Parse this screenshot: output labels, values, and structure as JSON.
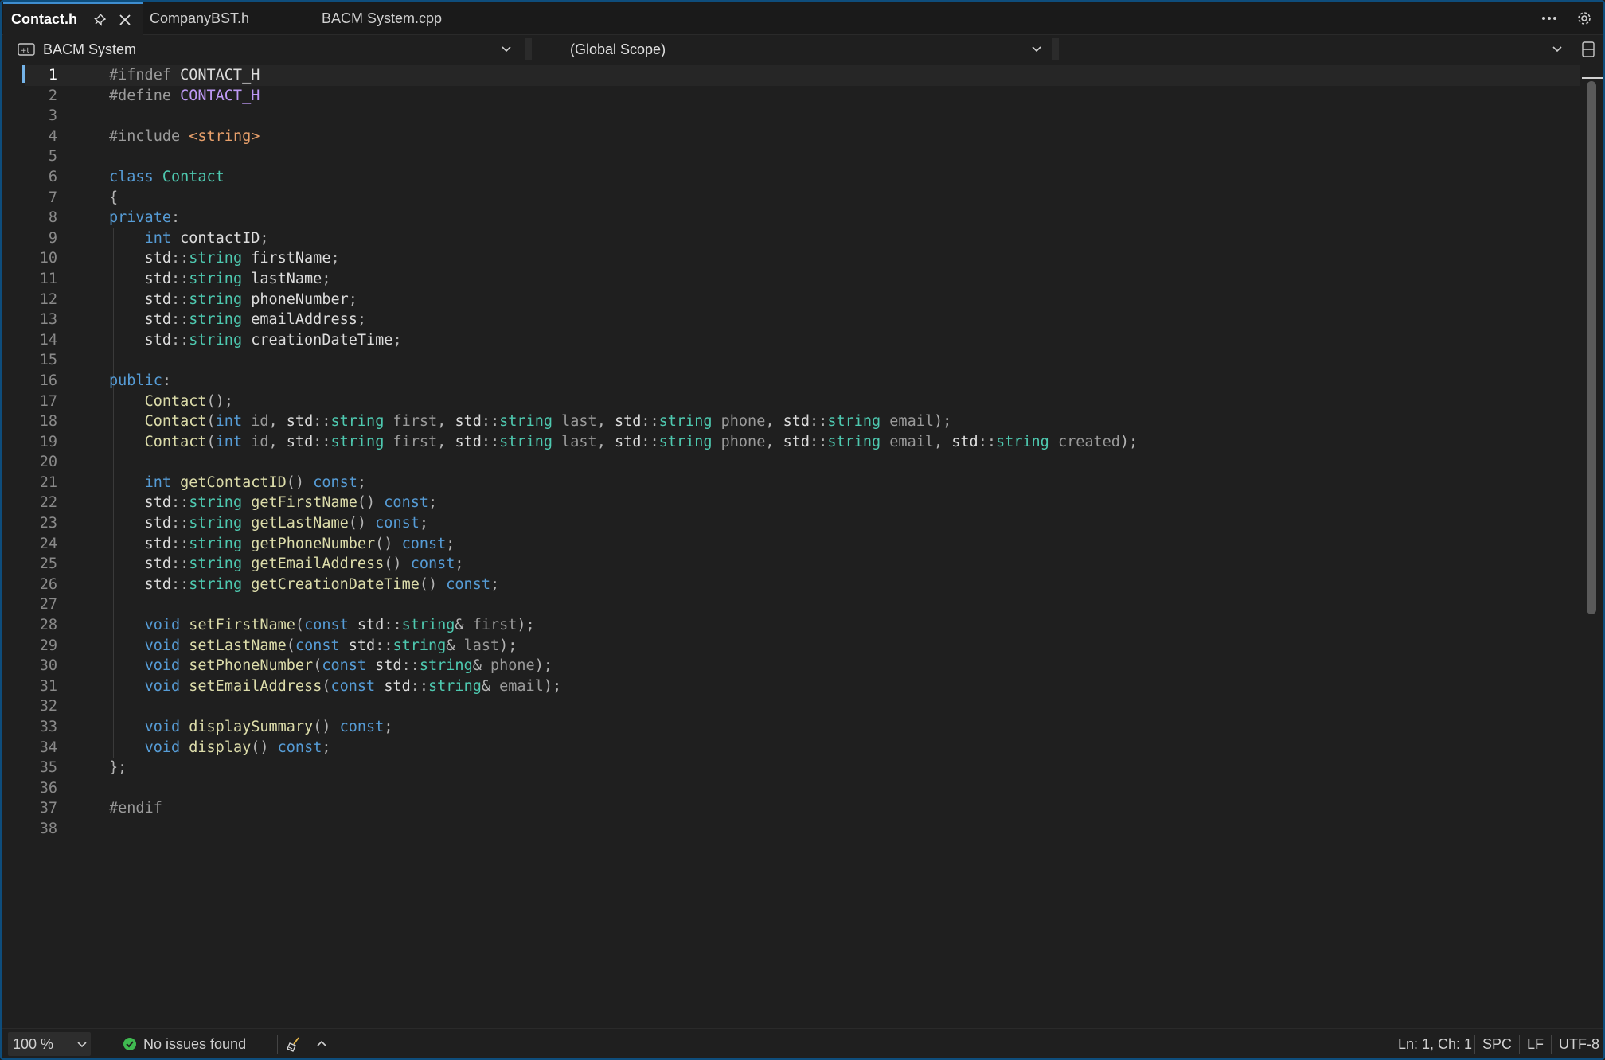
{
  "tabs": [
    {
      "label": "Contact.h",
      "active": true,
      "pinned": true
    },
    {
      "label": "CompanyBST.h",
      "active": false
    },
    {
      "label": "BACM System.cpp",
      "active": false
    }
  ],
  "navbar": {
    "project": "BACM System",
    "scope": "(Global Scope)",
    "member": ""
  },
  "editor": {
    "current_line": 1,
    "lines": [
      {
        "n": "1",
        "t": [
          [
            "pp",
            "#ifndef "
          ],
          [
            "pl",
            "CONTACT_H"
          ]
        ]
      },
      {
        "n": "2",
        "t": [
          [
            "pp",
            "#define "
          ],
          [
            "mc",
            "CONTACT_H"
          ]
        ]
      },
      {
        "n": "3",
        "t": []
      },
      {
        "n": "4",
        "t": [
          [
            "pp",
            "#include "
          ],
          [
            "st",
            "<string>"
          ]
        ]
      },
      {
        "n": "5",
        "t": []
      },
      {
        "n": "6",
        "t": [
          [
            "kw",
            "class "
          ],
          [
            "ty",
            "Contact"
          ]
        ]
      },
      {
        "n": "7",
        "t": [
          [
            "op",
            "{"
          ]
        ]
      },
      {
        "n": "8",
        "t": [
          [
            "kw",
            "private"
          ],
          [
            "op",
            ":"
          ]
        ]
      },
      {
        "n": "9",
        "t": [
          [
            "pl",
            "    "
          ],
          [
            "kw",
            "int "
          ],
          [
            "pl",
            "contactID"
          ],
          [
            "op",
            ";"
          ]
        ]
      },
      {
        "n": "10",
        "t": [
          [
            "pl",
            "    std"
          ],
          [
            "op",
            "::"
          ],
          [
            "ty",
            "string "
          ],
          [
            "pl",
            "firstName"
          ],
          [
            "op",
            ";"
          ]
        ]
      },
      {
        "n": "11",
        "t": [
          [
            "pl",
            "    std"
          ],
          [
            "op",
            "::"
          ],
          [
            "ty",
            "string "
          ],
          [
            "pl",
            "lastName"
          ],
          [
            "op",
            ";"
          ]
        ]
      },
      {
        "n": "12",
        "t": [
          [
            "pl",
            "    std"
          ],
          [
            "op",
            "::"
          ],
          [
            "ty",
            "string "
          ],
          [
            "pl",
            "phoneNumber"
          ],
          [
            "op",
            ";"
          ]
        ]
      },
      {
        "n": "13",
        "t": [
          [
            "pl",
            "    std"
          ],
          [
            "op",
            "::"
          ],
          [
            "ty",
            "string "
          ],
          [
            "pl",
            "emailAddress"
          ],
          [
            "op",
            ";"
          ]
        ]
      },
      {
        "n": "14",
        "t": [
          [
            "pl",
            "    std"
          ],
          [
            "op",
            "::"
          ],
          [
            "ty",
            "string "
          ],
          [
            "pl",
            "creationDateTime"
          ],
          [
            "op",
            ";"
          ]
        ]
      },
      {
        "n": "15",
        "t": []
      },
      {
        "n": "16",
        "t": [
          [
            "kw",
            "public"
          ],
          [
            "op",
            ":"
          ]
        ]
      },
      {
        "n": "17",
        "t": [
          [
            "pl",
            "    "
          ],
          [
            "fn",
            "Contact"
          ],
          [
            "op",
            "();"
          ]
        ]
      },
      {
        "n": "18",
        "t": [
          [
            "pl",
            "    "
          ],
          [
            "fn",
            "Contact"
          ],
          [
            "op",
            "("
          ],
          [
            "kw",
            "int "
          ],
          [
            "pm",
            "id"
          ],
          [
            "op",
            ", "
          ],
          [
            "pl",
            "std"
          ],
          [
            "op",
            "::"
          ],
          [
            "ty",
            "string "
          ],
          [
            "pm",
            "first"
          ],
          [
            "op",
            ", "
          ],
          [
            "pl",
            "std"
          ],
          [
            "op",
            "::"
          ],
          [
            "ty",
            "string "
          ],
          [
            "pm",
            "last"
          ],
          [
            "op",
            ", "
          ],
          [
            "pl",
            "std"
          ],
          [
            "op",
            "::"
          ],
          [
            "ty",
            "string "
          ],
          [
            "pm",
            "phone"
          ],
          [
            "op",
            ", "
          ],
          [
            "pl",
            "std"
          ],
          [
            "op",
            "::"
          ],
          [
            "ty",
            "string "
          ],
          [
            "pm",
            "email"
          ],
          [
            "op",
            ");"
          ]
        ]
      },
      {
        "n": "19",
        "t": [
          [
            "pl",
            "    "
          ],
          [
            "fn",
            "Contact"
          ],
          [
            "op",
            "("
          ],
          [
            "kw",
            "int "
          ],
          [
            "pm",
            "id"
          ],
          [
            "op",
            ", "
          ],
          [
            "pl",
            "std"
          ],
          [
            "op",
            "::"
          ],
          [
            "ty",
            "string "
          ],
          [
            "pm",
            "first"
          ],
          [
            "op",
            ", "
          ],
          [
            "pl",
            "std"
          ],
          [
            "op",
            "::"
          ],
          [
            "ty",
            "string "
          ],
          [
            "pm",
            "last"
          ],
          [
            "op",
            ", "
          ],
          [
            "pl",
            "std"
          ],
          [
            "op",
            "::"
          ],
          [
            "ty",
            "string "
          ],
          [
            "pm",
            "phone"
          ],
          [
            "op",
            ", "
          ],
          [
            "pl",
            "std"
          ],
          [
            "op",
            "::"
          ],
          [
            "ty",
            "string "
          ],
          [
            "pm",
            "email"
          ],
          [
            "op",
            ", "
          ],
          [
            "pl",
            "std"
          ],
          [
            "op",
            "::"
          ],
          [
            "ty",
            "string "
          ],
          [
            "pm",
            "created"
          ],
          [
            "op",
            ");"
          ]
        ]
      },
      {
        "n": "20",
        "t": []
      },
      {
        "n": "21",
        "t": [
          [
            "pl",
            "    "
          ],
          [
            "kw",
            "int "
          ],
          [
            "fn",
            "getContactID"
          ],
          [
            "op",
            "() "
          ],
          [
            "kw",
            "const"
          ],
          [
            "op",
            ";"
          ]
        ]
      },
      {
        "n": "22",
        "t": [
          [
            "pl",
            "    std"
          ],
          [
            "op",
            "::"
          ],
          [
            "ty",
            "string "
          ],
          [
            "fn",
            "getFirstName"
          ],
          [
            "op",
            "() "
          ],
          [
            "kw",
            "const"
          ],
          [
            "op",
            ";"
          ]
        ]
      },
      {
        "n": "23",
        "t": [
          [
            "pl",
            "    std"
          ],
          [
            "op",
            "::"
          ],
          [
            "ty",
            "string "
          ],
          [
            "fn",
            "getLastName"
          ],
          [
            "op",
            "() "
          ],
          [
            "kw",
            "const"
          ],
          [
            "op",
            ";"
          ]
        ]
      },
      {
        "n": "24",
        "t": [
          [
            "pl",
            "    std"
          ],
          [
            "op",
            "::"
          ],
          [
            "ty",
            "string "
          ],
          [
            "fn",
            "getPhoneNumber"
          ],
          [
            "op",
            "() "
          ],
          [
            "kw",
            "const"
          ],
          [
            "op",
            ";"
          ]
        ]
      },
      {
        "n": "25",
        "t": [
          [
            "pl",
            "    std"
          ],
          [
            "op",
            "::"
          ],
          [
            "ty",
            "string "
          ],
          [
            "fn",
            "getEmailAddress"
          ],
          [
            "op",
            "() "
          ],
          [
            "kw",
            "const"
          ],
          [
            "op",
            ";"
          ]
        ]
      },
      {
        "n": "26",
        "t": [
          [
            "pl",
            "    std"
          ],
          [
            "op",
            "::"
          ],
          [
            "ty",
            "string "
          ],
          [
            "fn",
            "getCreationDateTime"
          ],
          [
            "op",
            "() "
          ],
          [
            "kw",
            "const"
          ],
          [
            "op",
            ";"
          ]
        ]
      },
      {
        "n": "27",
        "t": []
      },
      {
        "n": "28",
        "t": [
          [
            "pl",
            "    "
          ],
          [
            "kw",
            "void "
          ],
          [
            "fn",
            "setFirstName"
          ],
          [
            "op",
            "("
          ],
          [
            "kw",
            "const "
          ],
          [
            "pl",
            "std"
          ],
          [
            "op",
            "::"
          ],
          [
            "ty",
            "string"
          ],
          [
            "op",
            "& "
          ],
          [
            "pm",
            "first"
          ],
          [
            "op",
            ");"
          ]
        ]
      },
      {
        "n": "29",
        "t": [
          [
            "pl",
            "    "
          ],
          [
            "kw",
            "void "
          ],
          [
            "fn",
            "setLastName"
          ],
          [
            "op",
            "("
          ],
          [
            "kw",
            "const "
          ],
          [
            "pl",
            "std"
          ],
          [
            "op",
            "::"
          ],
          [
            "ty",
            "string"
          ],
          [
            "op",
            "& "
          ],
          [
            "pm",
            "last"
          ],
          [
            "op",
            ");"
          ]
        ]
      },
      {
        "n": "30",
        "t": [
          [
            "pl",
            "    "
          ],
          [
            "kw",
            "void "
          ],
          [
            "fn",
            "setPhoneNumber"
          ],
          [
            "op",
            "("
          ],
          [
            "kw",
            "const "
          ],
          [
            "pl",
            "std"
          ],
          [
            "op",
            "::"
          ],
          [
            "ty",
            "string"
          ],
          [
            "op",
            "& "
          ],
          [
            "pm",
            "phone"
          ],
          [
            "op",
            ");"
          ]
        ]
      },
      {
        "n": "31",
        "t": [
          [
            "pl",
            "    "
          ],
          [
            "kw",
            "void "
          ],
          [
            "fn",
            "setEmailAddress"
          ],
          [
            "op",
            "("
          ],
          [
            "kw",
            "const "
          ],
          [
            "pl",
            "std"
          ],
          [
            "op",
            "::"
          ],
          [
            "ty",
            "string"
          ],
          [
            "op",
            "& "
          ],
          [
            "pm",
            "email"
          ],
          [
            "op",
            ");"
          ]
        ]
      },
      {
        "n": "32",
        "t": []
      },
      {
        "n": "33",
        "t": [
          [
            "pl",
            "    "
          ],
          [
            "kw",
            "void "
          ],
          [
            "fn",
            "displaySummary"
          ],
          [
            "op",
            "() "
          ],
          [
            "kw",
            "const"
          ],
          [
            "op",
            ";"
          ]
        ]
      },
      {
        "n": "34",
        "t": [
          [
            "pl",
            "    "
          ],
          [
            "kw",
            "void "
          ],
          [
            "fn",
            "display"
          ],
          [
            "op",
            "() "
          ],
          [
            "kw",
            "const"
          ],
          [
            "op",
            ";"
          ]
        ]
      },
      {
        "n": "35",
        "t": [
          [
            "op",
            "};"
          ]
        ]
      },
      {
        "n": "36",
        "t": []
      },
      {
        "n": "37",
        "t": [
          [
            "pp",
            "#endif"
          ]
        ]
      },
      {
        "n": "38",
        "t": []
      }
    ]
  },
  "statusbar": {
    "zoom": "100 %",
    "issues": "No issues found",
    "position": "Ln: 1, Ch: 1",
    "whitespace": "SPC",
    "line_ending": "LF",
    "encoding": "UTF-8"
  },
  "colors": {
    "keyword": "#569cd6",
    "type": "#4ec9b0",
    "function": "#dcdcaa",
    "preprocessor": "#9b9b9b",
    "macro": "#bd98f4",
    "string": "#e8a06b",
    "parameter": "#9a9a9a",
    "accent": "#3e8ed0",
    "ok": "#3fb950"
  },
  "icons": {
    "pin": "pin-icon",
    "close": "close-icon",
    "overflow": "more-horizontal-icon",
    "settings": "gear-icon",
    "project": "cpp-project-icon",
    "chevron": "chevron-down-icon",
    "split": "split-editor-icon",
    "issues": "check-circle-icon",
    "cleanup": "broom-icon",
    "expand": "chevron-up-icon"
  }
}
